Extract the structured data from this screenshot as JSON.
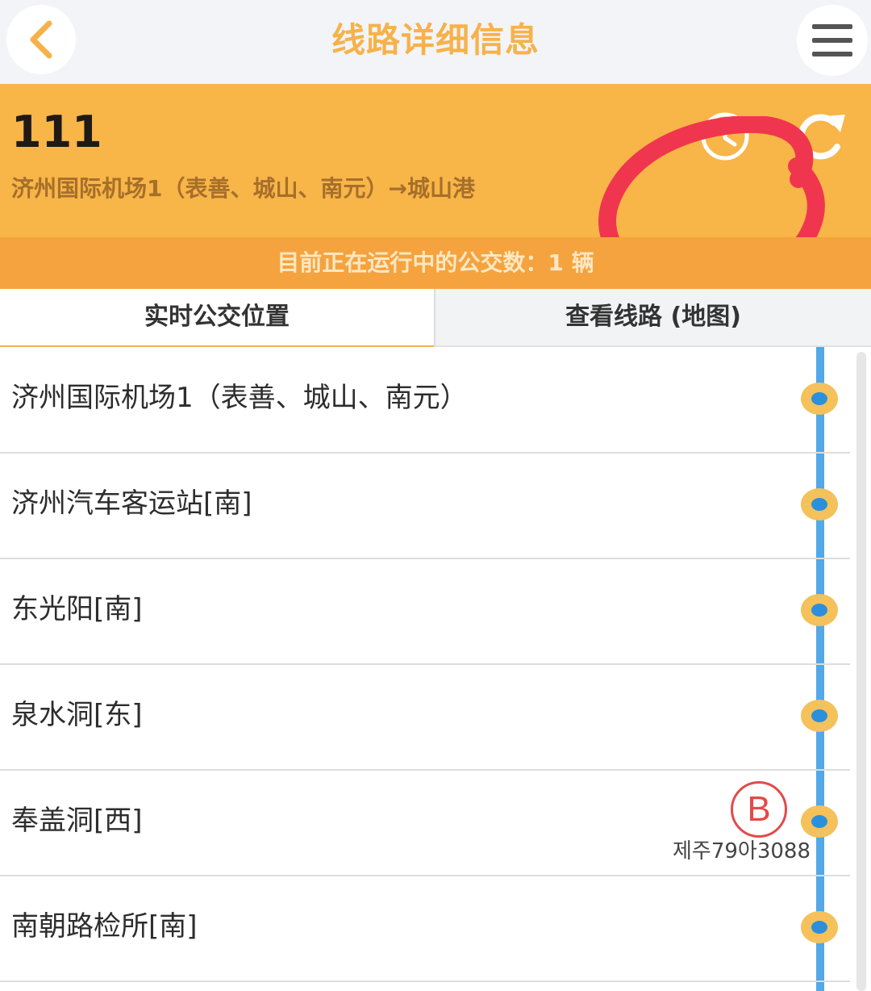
{
  "header": {
    "title": "线路详细信息",
    "back_icon": "chevron-left-icon",
    "menu_icon": "hamburger-menu-icon"
  },
  "route": {
    "number": "111",
    "description": "济州国际机场1（表善、城山、南元）→城山港",
    "clock_icon": "clock-icon",
    "refresh_icon": "refresh-icon"
  },
  "banner": {
    "text": "目前正在运行中的公交数：1 辆"
  },
  "tabs": [
    {
      "label": "实时公交位置",
      "active": true
    },
    {
      "label": "查看线路 (地图)",
      "active": false
    }
  ],
  "stops": [
    {
      "name": "济州国际机场1（表善、城山、南元）"
    },
    {
      "name": "济州汽车客运站[南]"
    },
    {
      "name": "东光阳[南]"
    },
    {
      "name": "泉水洞[东]"
    },
    {
      "name": "奉盖洞[西]",
      "bus": {
        "badge": "B",
        "plate": "제주79아3088"
      }
    },
    {
      "name": "南朝路检所[南]"
    }
  ],
  "colors": {
    "accent": "#f8b548",
    "banner": "#f5a33e",
    "route_line": "#52a8e8",
    "stop_dot": "#f4c15a",
    "annotation": "#f0364f"
  }
}
